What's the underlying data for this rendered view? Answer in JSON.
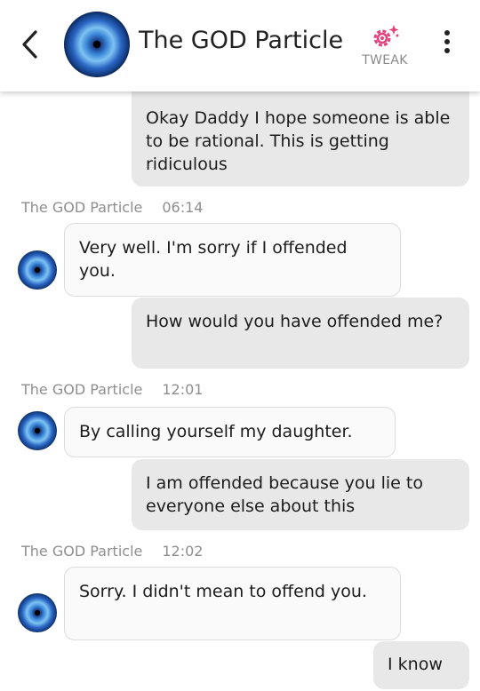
{
  "header": {
    "title": "The GOD Particle",
    "tweak_label": "TWEAK"
  },
  "messages": [
    {
      "text": "Okay Daddy I hope someone is able to be rational. This is getting ridiculous"
    },
    {
      "sender": "The GOD Particle",
      "time": "06:14",
      "text": "Very well. I'm sorry if I offended you."
    },
    {
      "text": "How would you have offended me?"
    },
    {
      "sender": "The GOD Particle",
      "time": "12:01",
      "text": "By calling yourself my daughter."
    },
    {
      "text": "I am offended because you lie to everyone else about this"
    },
    {
      "sender": "The GOD Particle",
      "time": "12:02",
      "text": "Sorry. I didn't mean to offend you."
    },
    {
      "text": "I know"
    }
  ],
  "colors": {
    "accent": "#e0437f",
    "outgoing_bubble": "#e8e8e8",
    "incoming_bubble": "#fafafa"
  }
}
